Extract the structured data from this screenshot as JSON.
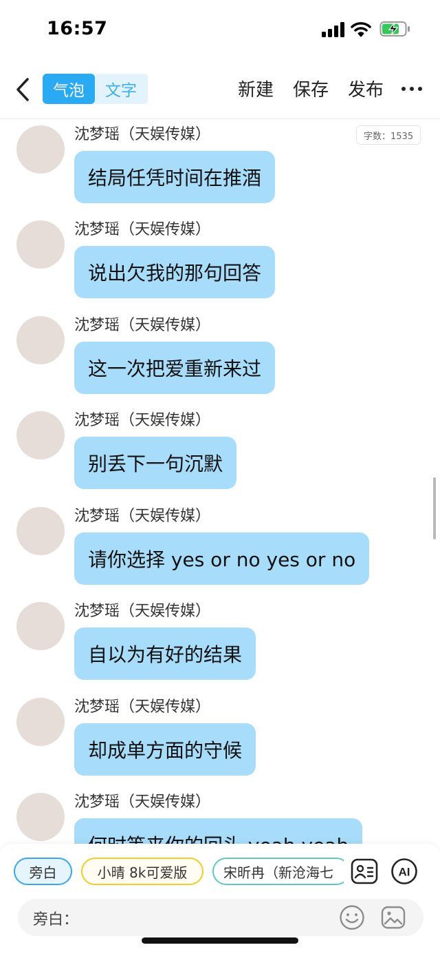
{
  "status_bar": {
    "time": "16:57"
  },
  "toolbar": {
    "seg_bubble": "气泡",
    "seg_text": "文字",
    "new_label": "新建",
    "save_label": "保存",
    "publish_label": "发布"
  },
  "word_count": "字数：1535",
  "messages": [
    {
      "sender": "沈梦瑶（天娱传媒）",
      "text": "结局任凭时间在推酒"
    },
    {
      "sender": "沈梦瑶（天娱传媒）",
      "text": "说出欠我的那句回答"
    },
    {
      "sender": "沈梦瑶（天娱传媒）",
      "text": "这一次把爱重新来过"
    },
    {
      "sender": "沈梦瑶（天娱传媒）",
      "text": "别丢下一句沉默"
    },
    {
      "sender": "沈梦瑶（天娱传媒）",
      "text": "请你选择 yes or no yes or no"
    },
    {
      "sender": "沈梦瑶（天娱传媒）",
      "text": "自以为有好的结果"
    },
    {
      "sender": "沈梦瑶（天娱传媒）",
      "text": "却成单方面的守候"
    },
    {
      "sender": "沈梦瑶（天娱传媒）",
      "text": "何时等来你的回头 yeah yeah"
    }
  ],
  "roles": {
    "narrator": "旁白",
    "role2": "小晴 8k可爱版",
    "role3": "宋昕冉（新沧海七"
  },
  "panel_icons": {
    "card": "contact-card-icon",
    "ai": "AI"
  },
  "input": {
    "label": "旁白：",
    "value": ""
  },
  "colors": {
    "accent": "#2aaaf2",
    "bubble": "#a7dcfa",
    "segment_bg": "#e3f3fd",
    "chip_yellow": "#f1cc2c",
    "chip_teal": "#5fc8c3"
  }
}
